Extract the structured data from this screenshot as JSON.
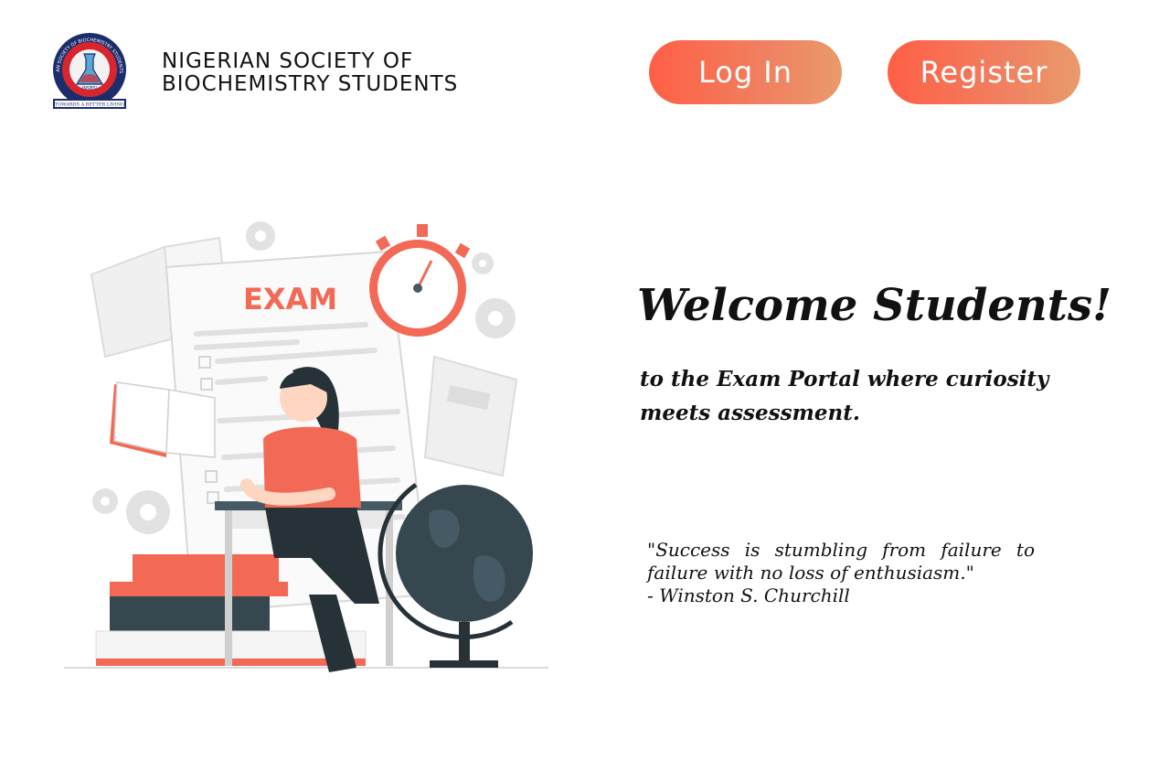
{
  "header": {
    "logo": {
      "icon": "nsbs-seal-logo",
      "ring_text": "NIGERIAN SOCIETY OF BIOCHEMISTRY STUDENTS",
      "inner_text": "(NSBS)",
      "banner_text": "TOWARDS A BETTER LIVING"
    },
    "org_name_line1": "NIGERIAN SOCIETY OF",
    "org_name_line2": "BIOCHEMISTRY STUDENTS",
    "login_label": "Log In",
    "register_label": "Register"
  },
  "hero": {
    "illustration": {
      "icon": "student-exam-illustration",
      "exam_label": "EXAM"
    },
    "welcome_title": "Welcome Students!",
    "intro_text": "to the Exam Portal where curiosity meets assessment.",
    "quote_text": "\"Success is stumbling from failure to failure with no loss of enthusiasm.\"",
    "quote_author": "- Winston S. Churchill"
  },
  "colors": {
    "accent": "#ff5f45",
    "accent_end": "#e99a6c",
    "illustration_red": "#f26a55",
    "illustration_dark": "#263238"
  }
}
